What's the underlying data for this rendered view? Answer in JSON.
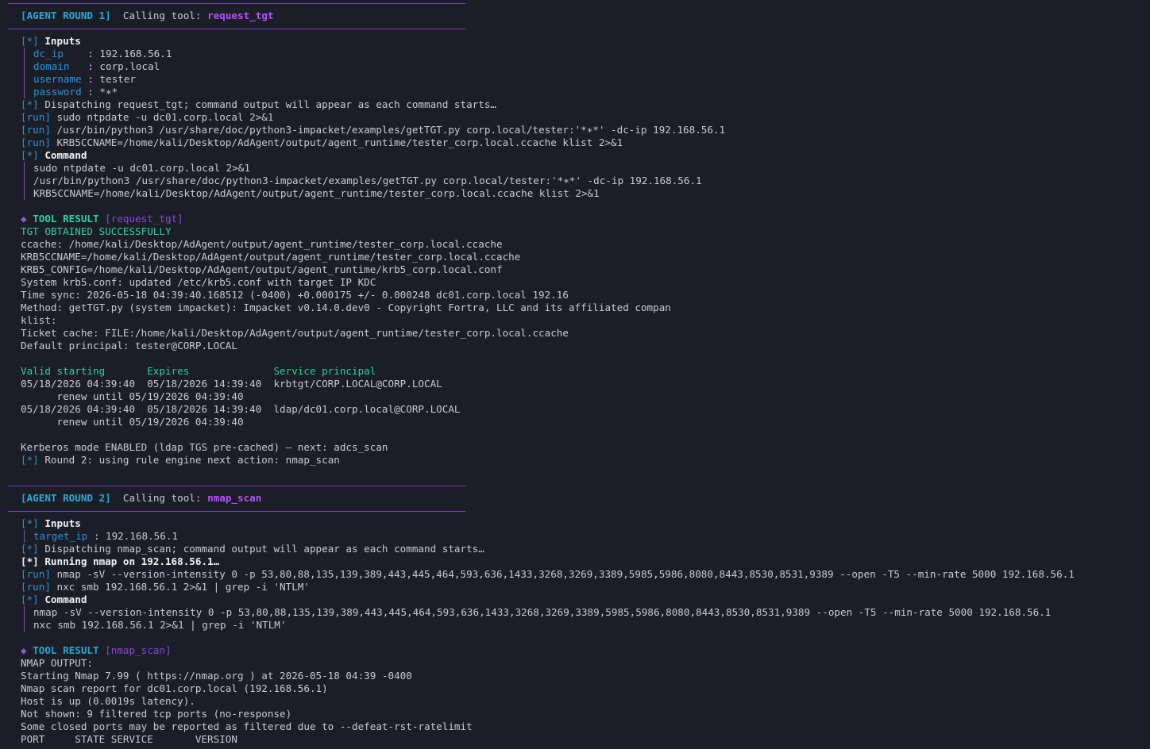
{
  "round1": {
    "header": {
      "tag": "[AGENT ROUND 1]",
      "calling": "Calling tool:",
      "tool": "request_tgt"
    },
    "inputs_tag": "[*]",
    "inputs_title": "Inputs",
    "inputs": [
      {
        "key": "dc_ip   ",
        "val": " : 192.168.56.1"
      },
      {
        "key": "domain  ",
        "val": " : corp.local"
      },
      {
        "key": "username",
        "val": " : tester"
      },
      {
        "key": "password",
        "val": " : *∗*"
      }
    ],
    "dispatch": {
      "tag": "[*]",
      "text": " Dispatching request_tgt; command output will appear as each command starts…"
    },
    "runs": [
      {
        "tag": "[run]",
        "text": " sudo ntpdate -u dc01.corp.local 2>&1"
      },
      {
        "tag": "[run]",
        "text": " /usr/bin/python3 /usr/share/doc/python3-impacket/examples/getTGT.py corp.local/tester:'*∗*' -dc-ip 192.168.56.1"
      },
      {
        "tag": "[run]",
        "text": " KRB5CCNAME=/home/kali/Desktop/AdAgent/output/agent_runtime/tester_corp.local.ccache klist 2>&1"
      }
    ],
    "command_tag": "[*]",
    "command_title": "Command",
    "commands": [
      "sudo ntpdate -u dc01.corp.local 2>&1",
      "/usr/bin/python3 /usr/share/doc/python3-impacket/examples/getTGT.py corp.local/tester:'*∗*' -dc-ip 192.168.56.1",
      "KRB5CCNAME=/home/kali/Desktop/AdAgent/output/agent_runtime/tester_corp.local.ccache klist 2>&1"
    ],
    "result": {
      "diamond": "◆",
      "title": "TOOL RESULT",
      "tool": "[request_tgt]"
    },
    "success": "TGT OBTAINED SUCCESSFULLY",
    "output": [
      "ccache: /home/kali/Desktop/AdAgent/output/agent_runtime/tester_corp.local.ccache",
      "KRB5CCNAME=/home/kali/Desktop/AdAgent/output/agent_runtime/tester_corp.local.ccache",
      "KRB5_CONFIG=/home/kali/Desktop/AdAgent/output/agent_runtime/krb5_corp.local.conf",
      "System krb5.conf: updated /etc/krb5.conf with target IP KDC",
      "Time sync: 2026-05-18 04:39:40.168512 (-0400) +0.000175 +/- 0.000248 dc01.corp.local 192.16",
      "Method: getTGT.py (system impacket): Impacket v0.14.0.dev0 - Copyright Fortra, LLC and its affiliated compan",
      "klist:",
      "Ticket cache: FILE:/home/kali/Desktop/AdAgent/output/agent_runtime/tester_corp.local.ccache",
      "Default principal: tester@CORP.LOCAL"
    ],
    "table_header": "Valid starting       Expires              Service principal",
    "tickets": [
      "05/18/2026 04:39:40  05/18/2026 14:39:40  krbtgt/CORP.LOCAL@CORP.LOCAL",
      "      renew until 05/19/2026 04:39:40",
      "05/18/2026 04:39:40  05/18/2026 14:39:40  ldap/dc01.corp.local@CORP.LOCAL",
      "      renew until 05/19/2026 04:39:40"
    ],
    "kerberos": "Kerberos mode ENABLED (ldap TGS pre-cached) — next: adcs_scan",
    "next": {
      "tag": "[*]",
      "text": " Round 2: using rule engine next action: nmap_scan"
    }
  },
  "round2": {
    "header": {
      "tag": "[AGENT ROUND 2]",
      "calling": "Calling tool:",
      "tool": "nmap_scan"
    },
    "inputs_tag": "[*]",
    "inputs_title": "Inputs",
    "inputs": [
      {
        "key": "target_ip",
        "val": " : 192.168.56.1"
      }
    ],
    "dispatch": {
      "tag": "[*]",
      "text": " Dispatching nmap_scan; command output will appear as each command starts…"
    },
    "running": {
      "tag": "[*]",
      "text": " Running nmap on 192.168.56.1…"
    },
    "runs": [
      {
        "tag": "[run]",
        "text": " nmap -sV --version-intensity 0 -p 53,80,88,135,139,389,443,445,464,593,636,1433,3268,3269,3389,5985,5986,8080,8443,8530,8531,9389 --open -T5 --min-rate 5000 192.168.56.1"
      },
      {
        "tag": "[run]",
        "text": " nxc smb 192.168.56.1 2>&1 | grep -i 'NTLM'"
      }
    ],
    "command_tag": "[*]",
    "command_title": "Command",
    "commands": [
      "nmap -sV --version-intensity 0 -p 53,80,88,135,139,389,443,445,464,593,636,1433,3268,3269,3389,5985,5986,8080,8443,8530,8531,9389 --open -T5 --min-rate 5000 192.168.56.1",
      "nxc smb 192.168.56.1 2>&1 | grep -i 'NTLM'"
    ],
    "result": {
      "diamond": "◆",
      "title": "TOOL RESULT",
      "tool": "[nmap_scan]"
    },
    "output": [
      "NMAP OUTPUT:",
      "Starting Nmap 7.99 ( https://nmap.org ) at 2026-05-18 04:39 -0400",
      "Nmap scan report for dc01.corp.local (192.168.56.1)",
      "Host is up (0.0019s latency).",
      "Not shown: 9 filtered tcp ports (no-response)",
      "Some closed ports may be reported as filtered due to --defeat-rst-ratelimit",
      "PORT     STATE SERVICE       VERSION"
    ]
  }
}
